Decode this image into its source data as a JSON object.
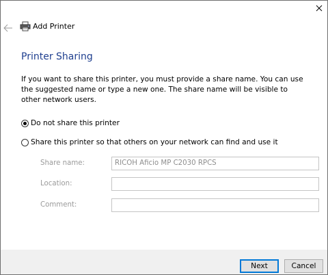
{
  "window": {
    "title": "Add Printer"
  },
  "page": {
    "heading": "Printer Sharing",
    "description": "If you want to share this printer, you must provide a share name. You can use the suggested name or type a new one. The share name will be visible to other network users."
  },
  "options": {
    "no_share": {
      "label": "Do not share this printer",
      "selected": true
    },
    "share": {
      "label": "Share this printer so that others on your network can find and use it",
      "selected": false
    }
  },
  "fields": {
    "share_name": {
      "label": "Share name:",
      "value": "RICOH Aficio MP C2030 RPCS"
    },
    "location": {
      "label": "Location:",
      "value": ""
    },
    "comment": {
      "label": "Comment:",
      "value": ""
    }
  },
  "buttons": {
    "next": "Next",
    "cancel": "Cancel"
  },
  "icons": {
    "close": "close-icon",
    "back": "back-arrow-icon",
    "printer": "printer-icon"
  },
  "colors": {
    "heading": "#1f3f8f",
    "accent": "#0078d7",
    "footer": "#f0f0f0",
    "disabled_text": "#9a9a9a"
  }
}
